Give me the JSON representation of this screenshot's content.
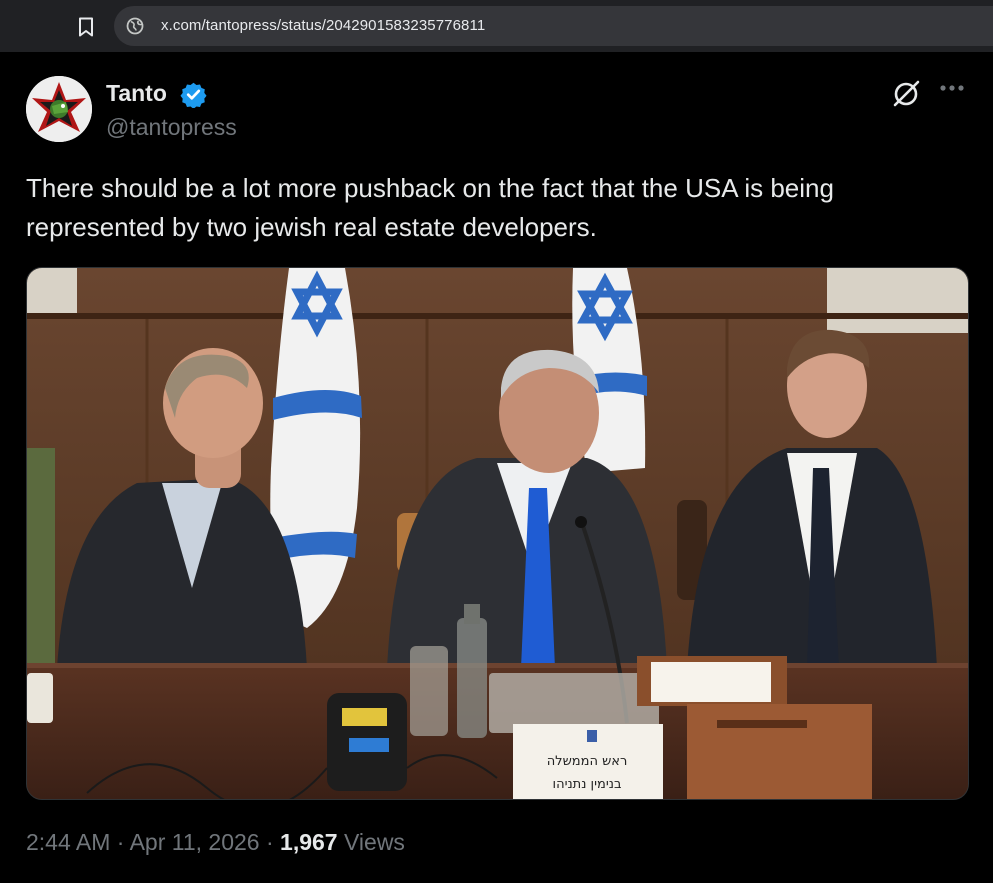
{
  "browser": {
    "url": "x.com/tantopress/status/2042901583235776811"
  },
  "tweet": {
    "author": {
      "display_name": "Tanto",
      "handle": "@tantopress",
      "verified": true
    },
    "text": "There should be a lot more pushback on the fact that the USA is being represented by two jewish real estate developers.",
    "image": {
      "nameplate_line1": "ראש הממשלה",
      "nameplate_line2": "בנימין נתניהו"
    },
    "time": "2:44 AM",
    "separator": "·",
    "date": "Apr 11, 2026",
    "views_count": "1,967",
    "views_label": "Views"
  },
  "colors": {
    "background": "#000000",
    "text_primary": "#e7e9ea",
    "text_secondary": "#71767b",
    "verified_blue": "#1d9bf0",
    "browser_bar": "#202124",
    "omnibox": "#35363a"
  },
  "icons": [
    "bookmark-icon",
    "globe-icon",
    "verified-icon",
    "grok-icon",
    "more-icon"
  ]
}
